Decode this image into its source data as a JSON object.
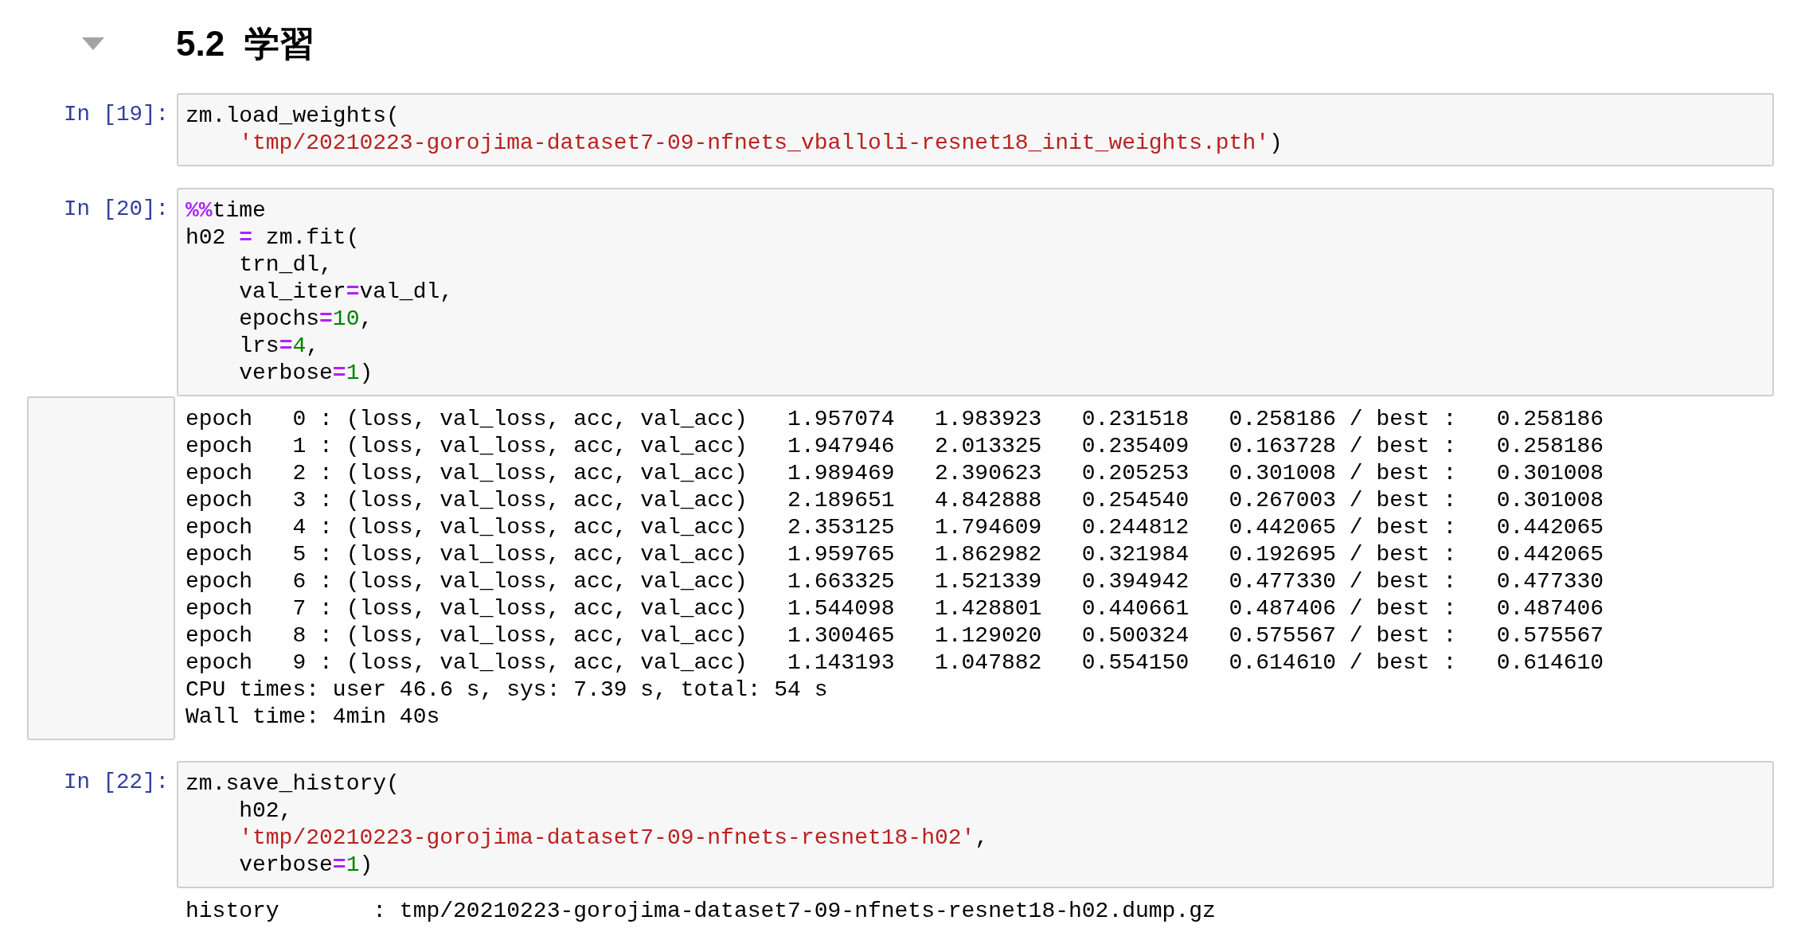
{
  "heading": {
    "text": "5.2  学習",
    "expanded": true
  },
  "cells": [
    {
      "prompt": "In [19]:",
      "code": [
        [
          {
            "kind": "plain",
            "text": "zm.load_weights("
          }
        ],
        [
          {
            "kind": "string",
            "text": "    'tmp/20210223-gorojima-dataset7-09-nfnets_vballoli-resnet18_init_weights.pth'"
          },
          {
            "kind": "plain",
            "text": ")"
          }
        ]
      ]
    },
    {
      "prompt": "In [20]:",
      "code": [
        [
          {
            "kind": "operator",
            "text": "%%"
          },
          {
            "kind": "plain",
            "text": "time"
          }
        ],
        [
          {
            "kind": "plain",
            "text": "h02 "
          },
          {
            "kind": "operator",
            "text": "="
          },
          {
            "kind": "plain",
            "text": " zm.fit("
          }
        ],
        [
          {
            "kind": "plain",
            "text": "    trn_dl,"
          }
        ],
        [
          {
            "kind": "plain",
            "text": "    val_iter"
          },
          {
            "kind": "operator",
            "text": "="
          },
          {
            "kind": "plain",
            "text": "val_dl,"
          }
        ],
        [
          {
            "kind": "plain",
            "text": "    epochs"
          },
          {
            "kind": "operator",
            "text": "="
          },
          {
            "kind": "number",
            "text": "10"
          },
          {
            "kind": "plain",
            "text": ","
          }
        ],
        [
          {
            "kind": "plain",
            "text": "    lrs"
          },
          {
            "kind": "operator",
            "text": "="
          },
          {
            "kind": "number",
            "text": "4"
          },
          {
            "kind": "plain",
            "text": ","
          }
        ],
        [
          {
            "kind": "plain",
            "text": "    verbose"
          },
          {
            "kind": "operator",
            "text": "="
          },
          {
            "kind": "number",
            "text": "1"
          },
          {
            "kind": "plain",
            "text": ")"
          }
        ]
      ],
      "output": {
        "framed": true,
        "lines": [
          "epoch   0 : (loss, val_loss, acc, val_acc)   1.957074   1.983923   0.231518   0.258186 / best :   0.258186",
          "epoch   1 : (loss, val_loss, acc, val_acc)   1.947946   2.013325   0.235409   0.163728 / best :   0.258186",
          "epoch   2 : (loss, val_loss, acc, val_acc)   1.989469   2.390623   0.205253   0.301008 / best :   0.301008",
          "epoch   3 : (loss, val_loss, acc, val_acc)   2.189651   4.842888   0.254540   0.267003 / best :   0.301008",
          "epoch   4 : (loss, val_loss, acc, val_acc)   2.353125   1.794609   0.244812   0.442065 / best :   0.442065",
          "epoch   5 : (loss, val_loss, acc, val_acc)   1.959765   1.862982   0.321984   0.192695 / best :   0.442065",
          "epoch   6 : (loss, val_loss, acc, val_acc)   1.663325   1.521339   0.394942   0.477330 / best :   0.477330",
          "epoch   7 : (loss, val_loss, acc, val_acc)   1.544098   1.428801   0.440661   0.487406 / best :   0.487406",
          "epoch   8 : (loss, val_loss, acc, val_acc)   1.300465   1.129020   0.500324   0.575567 / best :   0.575567",
          "epoch   9 : (loss, val_loss, acc, val_acc)   1.143193   1.047882   0.554150   0.614610 / best :   0.614610",
          "CPU times: user 46.6 s, sys: 7.39 s, total: 54 s",
          "Wall time: 4min 40s"
        ]
      }
    },
    {
      "prompt": "In [22]:",
      "code": [
        [
          {
            "kind": "plain",
            "text": "zm.save_history("
          }
        ],
        [
          {
            "kind": "plain",
            "text": "    h02,"
          }
        ],
        [
          {
            "kind": "string",
            "text": "    'tmp/20210223-gorojima-dataset7-09-nfnets-resnet18-h02'"
          },
          {
            "kind": "plain",
            "text": ","
          }
        ],
        [
          {
            "kind": "plain",
            "text": "    verbose"
          },
          {
            "kind": "operator",
            "text": "="
          },
          {
            "kind": "number",
            "text": "1"
          },
          {
            "kind": "plain",
            "text": ")"
          }
        ]
      ],
      "output": {
        "framed": false,
        "lines": [
          "history       : tmp/20210223-gorojima-dataset7-09-nfnets-resnet18-h02.dump.gz"
        ]
      }
    }
  ]
}
